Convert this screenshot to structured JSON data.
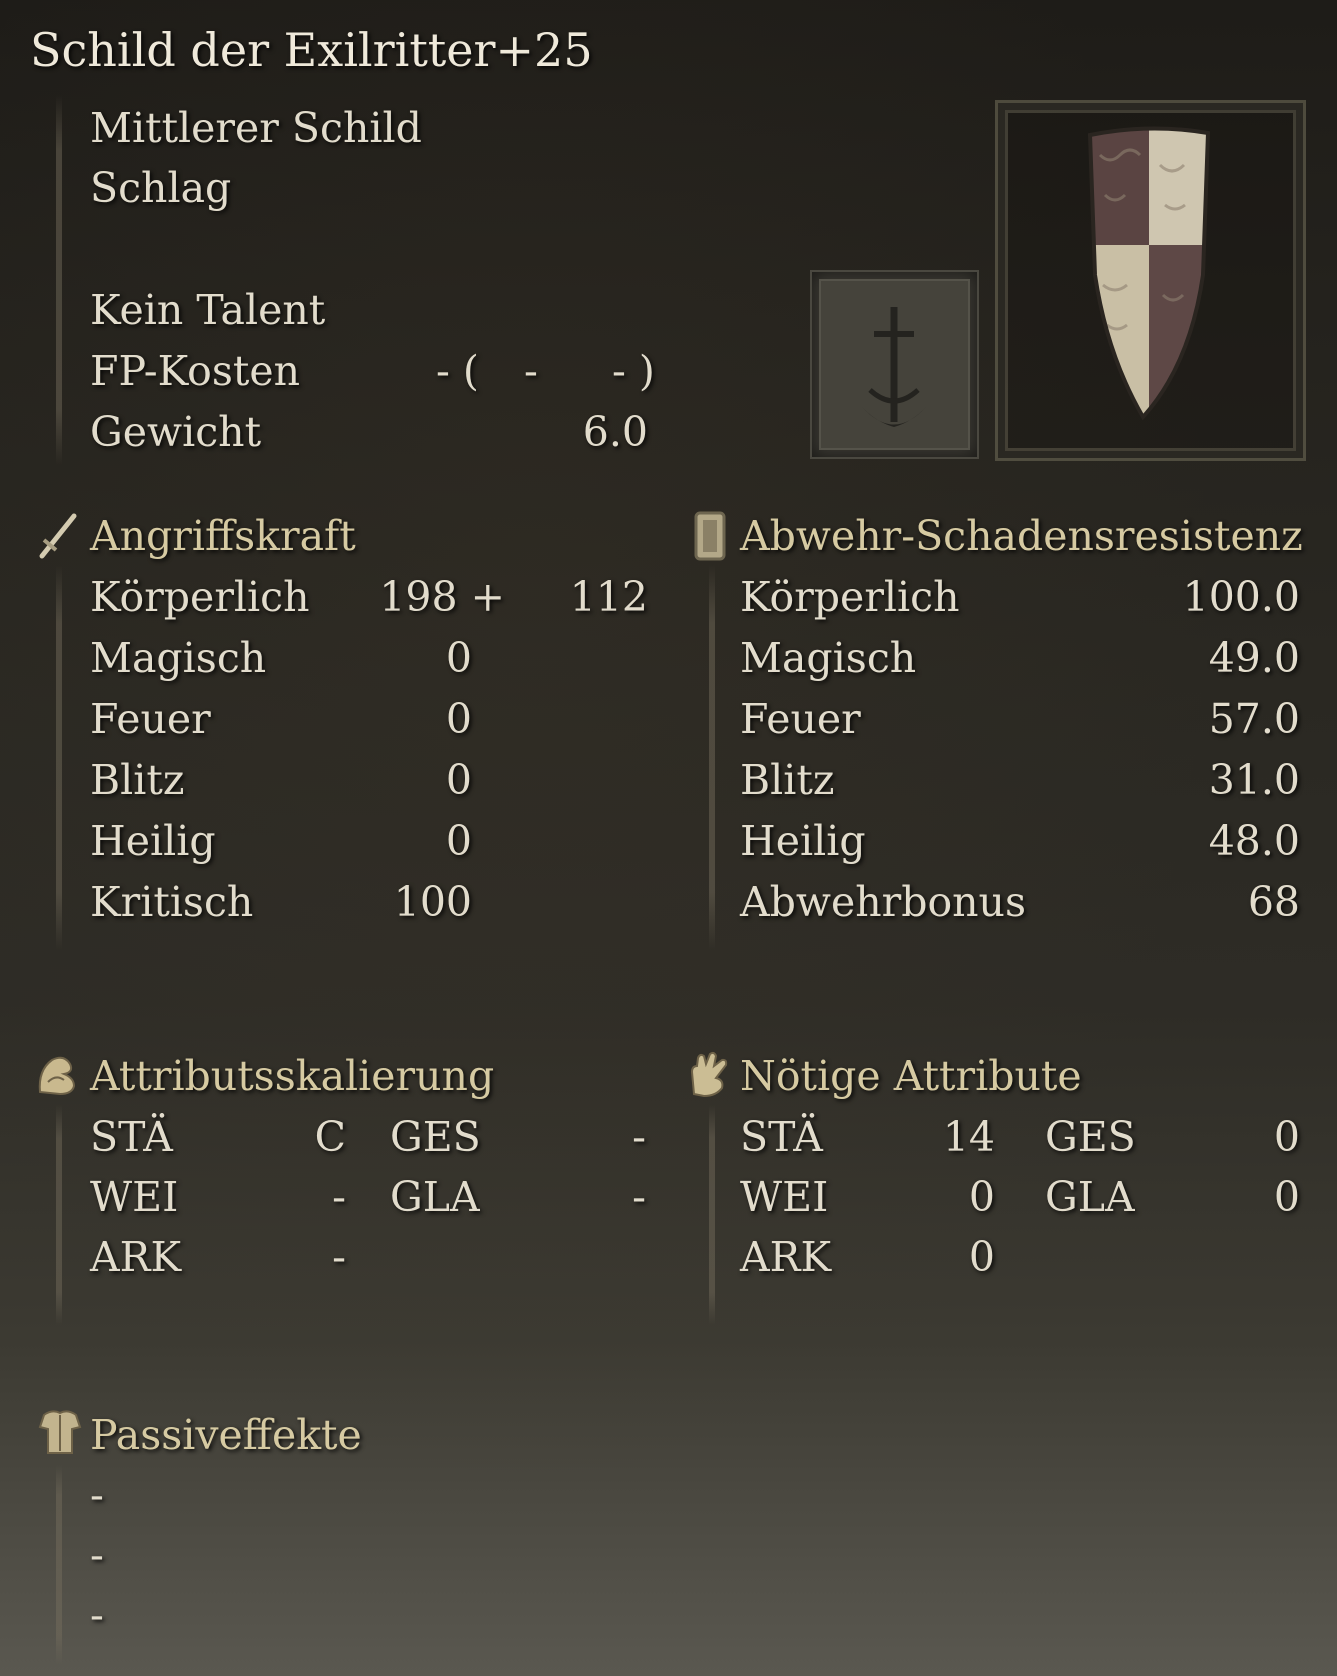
{
  "item": {
    "name": "Schild der Exilritter+25",
    "category": "Mittlerer Schild",
    "damage_type": "Schlag",
    "skill": "Kein Talent",
    "fp_label": "FP-Kosten",
    "fp_open": "- (",
    "fp_mid": "-",
    "fp_close": "- )",
    "weight_label": "Gewicht",
    "weight_value": "6.0"
  },
  "attack": {
    "title": "Angriffskraft",
    "rows": [
      {
        "label": "Körperlich",
        "value": "198 +",
        "bonus": "112"
      },
      {
        "label": "Magisch",
        "value": "0"
      },
      {
        "label": "Feuer",
        "value": "0"
      },
      {
        "label": "Blitz",
        "value": "0"
      },
      {
        "label": "Heilig",
        "value": "0"
      },
      {
        "label": "Kritisch",
        "value": "100"
      }
    ]
  },
  "guard": {
    "title": "Abwehr-Schadensresistenz",
    "rows": [
      {
        "label": "Körperlich",
        "value": "100.0"
      },
      {
        "label": "Magisch",
        "value": "49.0"
      },
      {
        "label": "Feuer",
        "value": "57.0"
      },
      {
        "label": "Blitz",
        "value": "31.0"
      },
      {
        "label": "Heilig",
        "value": "48.0"
      },
      {
        "label": "Abwehrbonus",
        "value": "68"
      }
    ]
  },
  "scaling": {
    "title": "Attributsskalierung",
    "str_label": "STÄ",
    "str_value": "C",
    "dex_label": "GES",
    "dex_value": "-",
    "int_label": "WEI",
    "int_value": "-",
    "fai_label": "GLA",
    "fai_value": "-",
    "arc_label": "ARK",
    "arc_value": "-"
  },
  "requirements": {
    "title": "Nötige Attribute",
    "str_label": "STÄ",
    "str_value": "14",
    "dex_label": "GES",
    "dex_value": "0",
    "int_label": "WEI",
    "int_value": "0",
    "fai_label": "GLA",
    "fai_value": "0",
    "arc_label": "ARK",
    "arc_value": "0"
  },
  "passive": {
    "title": "Passiveffekte",
    "items": [
      "-",
      "-",
      "-"
    ]
  },
  "icons": {
    "attack": "sword-icon",
    "guard": "shield-tablet-icon",
    "scaling": "flexed-arm-icon",
    "requirements": "raised-hand-icon",
    "passive": "armor-torso-icon",
    "emblem": "sword-emblem-icon",
    "item": "heater-shield-icon"
  },
  "colors": {
    "text": "#e2dccc",
    "heading": "#d6caa2",
    "background": "#2a2822"
  }
}
